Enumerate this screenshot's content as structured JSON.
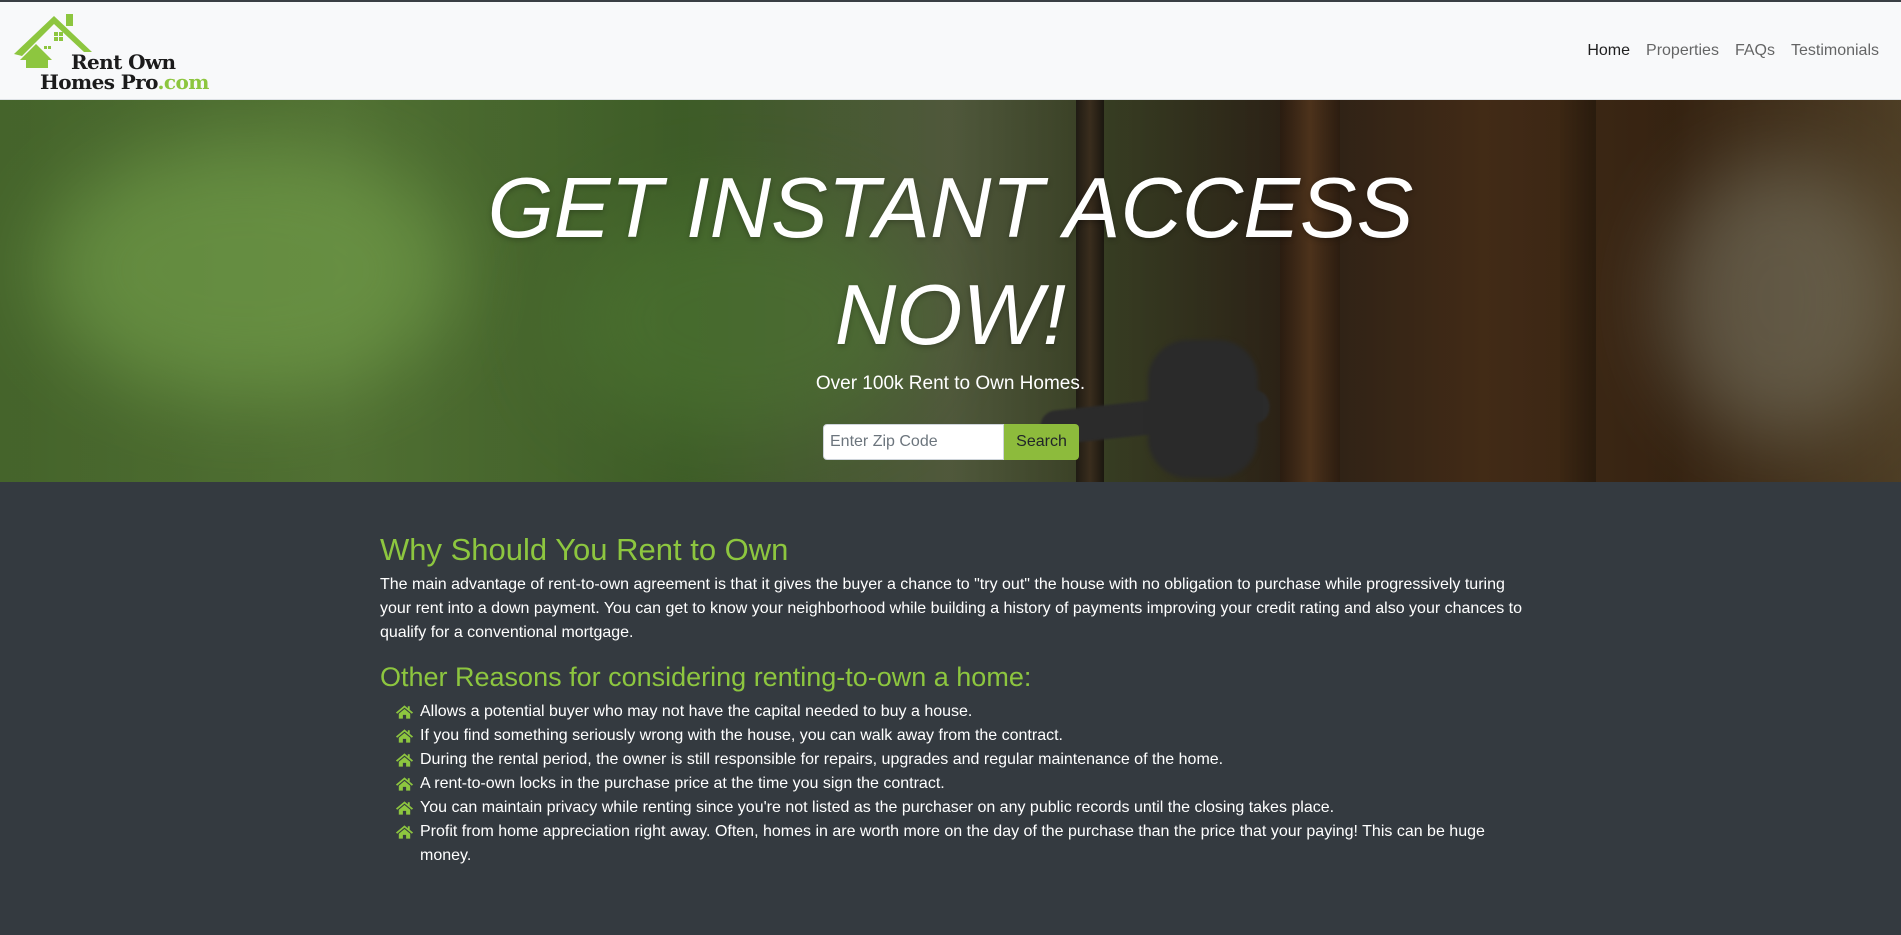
{
  "brand": {
    "line1": "Rent Own",
    "line2_main": "Homes Pro",
    "line2_tld": ".com",
    "green": "#8dc63f"
  },
  "nav": {
    "items": [
      {
        "label": "Home",
        "active": true
      },
      {
        "label": "Properties",
        "active": false
      },
      {
        "label": "FAQs",
        "active": false
      },
      {
        "label": "Testimonials",
        "active": false
      }
    ]
  },
  "hero": {
    "title_line1": "GET INSTANT ACCESS",
    "title_line2": "NOW!",
    "subtitle": "Over 100k Rent to Own Homes.",
    "search": {
      "placeholder": "Enter Zip Code",
      "value": "",
      "button_label": "Search",
      "button_color": "#8dbb3c"
    }
  },
  "main": {
    "heading": "Why Should You Rent to Own",
    "paragraph": "The main advantage of rent-to-own agreement is that it gives the buyer a chance to \"try out\" the house with no obligation to purchase while progressively turing your rent into a down payment. You can get to know your neighborhood while building a history of payments improving your credit rating and also your chances to qualify for a conventional mortgage.",
    "subheading": "Other Reasons for considering renting-to-own a home:",
    "bullet_icon": "home-icon",
    "reasons": [
      "Allows a potential buyer who may not have the capital needed to buy a house.",
      "If you find something seriously wrong with the house, you can walk away from the contract.",
      "During the rental period, the owner is still responsible for repairs, upgrades and regular maintenance of the home.",
      "A rent-to-own locks in the purchase price at the time you sign the contract.",
      "You can maintain privacy while renting since you're not listed as the purchaser on any public records until the closing takes place.",
      "Profit from home appreciation right away. Often, homes in are worth more on the day of the purchase than the price that your paying! This can be huge money."
    ]
  }
}
